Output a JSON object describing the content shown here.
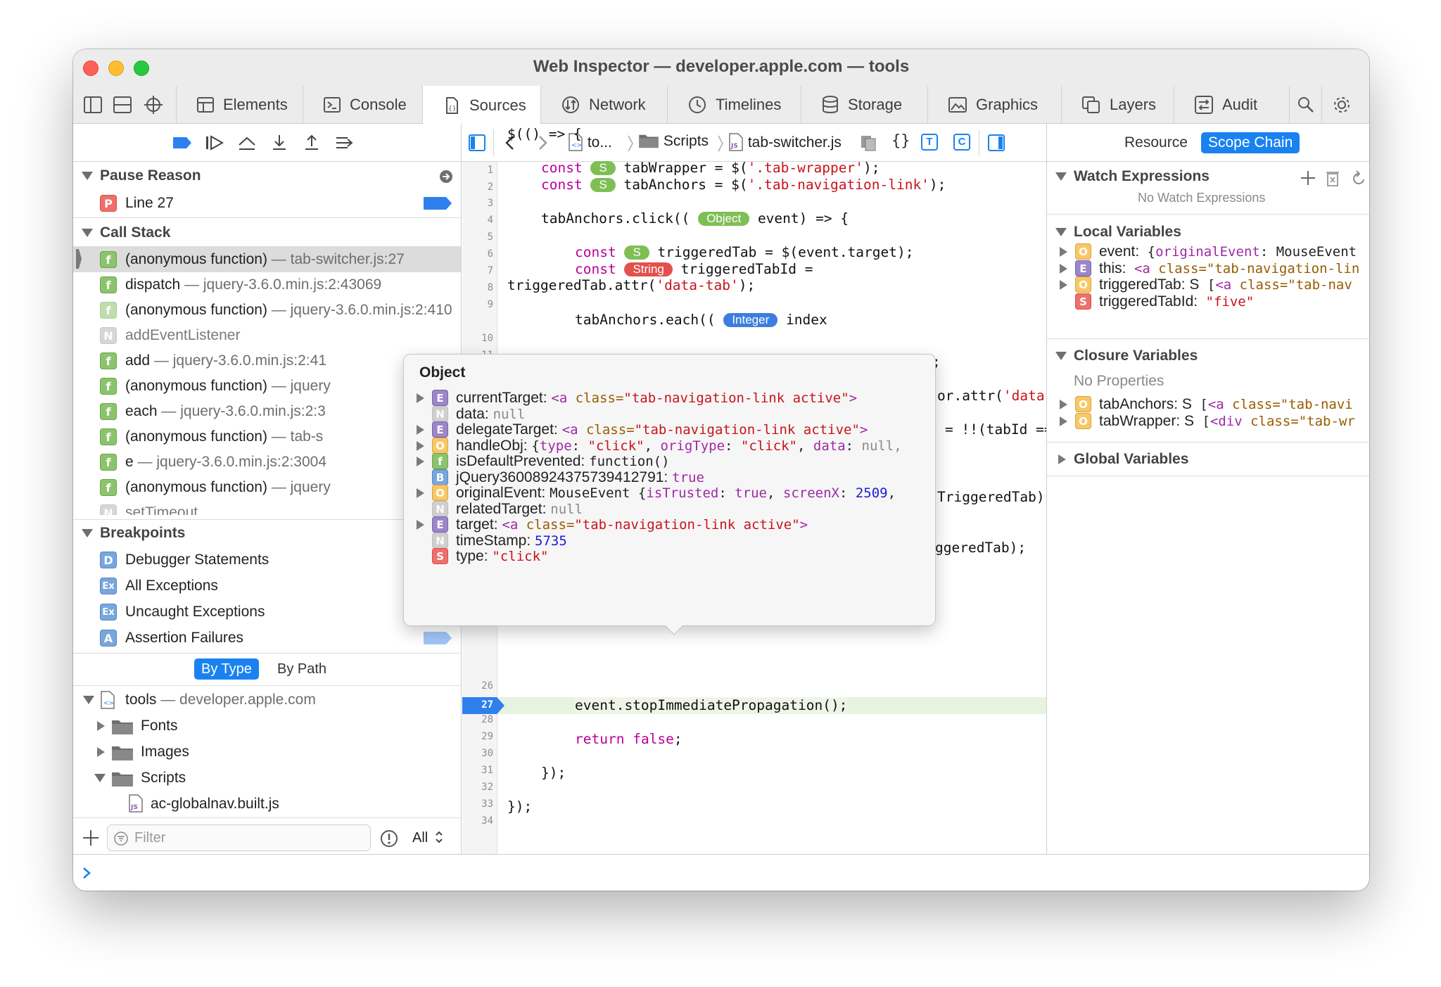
{
  "window": {
    "title": "Web Inspector — developer.apple.com — tools"
  },
  "tabs": [
    {
      "label": "Elements",
      "icon": "elements-icon"
    },
    {
      "label": "Console",
      "icon": "console-icon"
    },
    {
      "label": "Sources",
      "icon": "sources-icon",
      "active": true
    },
    {
      "label": "Network",
      "icon": "network-icon"
    },
    {
      "label": "Timelines",
      "icon": "timelines-icon"
    },
    {
      "label": "Storage",
      "icon": "storage-icon"
    },
    {
      "label": "Graphics",
      "icon": "graphics-icon"
    },
    {
      "label": "Layers",
      "icon": "layers-icon"
    },
    {
      "label": "Audit",
      "icon": "audit-icon"
    }
  ],
  "left": {
    "pause_reason_header": "Pause Reason",
    "pause_reason": {
      "badge": "P",
      "label": "Line 27"
    },
    "call_stack_header": "Call Stack",
    "call_stack": [
      {
        "badge": "f",
        "name": "(anonymous function)",
        "loc": "tab-switcher.js:27"
      },
      {
        "badge": "f",
        "name": "dispatch",
        "loc": "jquery-3.6.0.min.js:2:43069"
      },
      {
        "badge": "f",
        "name": "(anonymous function)",
        "loc": "jquery-3.6.0.min.js:2:410"
      },
      {
        "badge": "N",
        "name": "addEventListener",
        "loc": ""
      },
      {
        "badge": "f",
        "name": "add",
        "loc": "jquery-3.6.0.min.js:2:41"
      },
      {
        "badge": "f",
        "name": "(anonymous function)",
        "loc": "jquery"
      },
      {
        "badge": "f",
        "name": "each",
        "loc": "jquery-3.6.0.min.js:2:3"
      },
      {
        "badge": "f",
        "name": "(anonymous function)",
        "loc": "tab-s"
      },
      {
        "badge": "f",
        "name": "e",
        "loc": "jquery-3.6.0.min.js:2:3004"
      },
      {
        "badge": "f",
        "name": "(anonymous function)",
        "loc": "jquery"
      },
      {
        "badge": "N",
        "name": "setTimeout",
        "loc": ""
      }
    ],
    "breakpoints_header": "Breakpoints",
    "breakpoints": [
      {
        "badge": "D",
        "label": "Debugger Statements"
      },
      {
        "badge": "Ex",
        "label": "All Exceptions"
      },
      {
        "badge": "Ex",
        "label": "Uncaught Exceptions"
      },
      {
        "badge": "A",
        "label": "Assertion Failures"
      }
    ],
    "by_type": "By Type",
    "by_path": "By Path",
    "tree": {
      "root": "tools",
      "root_domain": "developer.apple.com",
      "folders": [
        "Fonts",
        "Images",
        "Scripts"
      ],
      "file": "ac-globalnav.built.js"
    },
    "filter_placeholder": "Filter",
    "filter_scope": "All"
  },
  "center": {
    "breadcrumb": [
      "to...",
      "Scripts",
      "tab-switcher.js"
    ],
    "toggle_t": "T",
    "toggle_c": "C",
    "line_numbers": [
      "1",
      "2",
      "3",
      "4",
      "5",
      "6",
      "7",
      "8",
      "9",
      "10",
      "11",
      "26",
      "27",
      "28",
      "29",
      "30",
      "31",
      "32",
      "33",
      "34"
    ],
    "current_line": "27",
    "code": {
      "l1": "$(() => {",
      "l3_kw": "const",
      "l3_type": "S",
      "l3_rest": " tabWrapper = $(",
      "l3_str": "'.tab-wrapper'",
      "l3_end": ");",
      "l4_kw": "const",
      "l4_type": "S",
      "l4_rest": " tabAnchors = $(",
      "l4_str": "'.tab-navigation-link'",
      "l4_end": ");",
      "l6_pre": "tabAnchors.click(( ",
      "l6_type": "Object",
      "l6_rest": " event) => {",
      "l8_kw": "const",
      "l8_type": "S",
      "l8_rest": " triggeredTab = $(event.target);",
      "l9_kw": "const",
      "l9_type": "String",
      "l9_rest": " triggeredTabId =",
      "l9b_pre": "triggeredTab.attr(",
      "l9b_str": "'data-tab'",
      "l9b_end": ");",
      "l11_pre": "tabAnchors.each(( ",
      "l11_type": "Integer",
      "l11_rest": " index",
      "f1": ";",
      "f2_pre": "or.attr(",
      "f2_str": "'data-tab'",
      "f2_end": ");",
      "f3": "= !!(tabId ===",
      "f4": "TriggeredTab);",
      "f5": "ggeredTab);",
      "l27": "event.stopImmediatePropagation();",
      "l29_kw": "return",
      "l29_kw2": "false",
      "l29_end": ";",
      "l31": "});",
      "l33": "});"
    }
  },
  "popover": {
    "title": "Object",
    "rows": [
      {
        "badge": "E",
        "key": "currentTarget:",
        "expandable": true,
        "kind": "element",
        "tag": "<a ",
        "attr": "class=",
        "val": "\"tab-navigation-link active\"",
        "close": ">"
      },
      {
        "badge": "N",
        "key": "data:",
        "expandable": false,
        "kind": "null",
        "text": "null"
      },
      {
        "badge": "E",
        "key": "delegateTarget:",
        "expandable": true,
        "kind": "element",
        "tag": "<a ",
        "attr": "class=",
        "val": "\"tab-navigation-link active\"",
        "close": ">"
      },
      {
        "badge": "O",
        "key": "handleObj:",
        "expandable": true,
        "kind": "handleobj"
      },
      {
        "badge": "f",
        "key": "isDefaultPrevented:",
        "expandable": true,
        "kind": "plain",
        "text": "function()"
      },
      {
        "badge": "B",
        "key": "jQuery36008924375739412791:",
        "expandable": false,
        "kind": "bool",
        "text": "true"
      },
      {
        "badge": "O",
        "key": "originalEvent:",
        "expandable": true,
        "kind": "origevent"
      },
      {
        "badge": "N",
        "key": "relatedTarget:",
        "expandable": false,
        "kind": "null",
        "text": "null"
      },
      {
        "badge": "E",
        "key": "target:",
        "expandable": true,
        "kind": "element",
        "tag": "<a ",
        "attr": "class=",
        "val": "\"tab-navigation-link active\"",
        "close": ">"
      },
      {
        "badge": "N",
        "key": "timeStamp:",
        "expandable": false,
        "kind": "number",
        "text": "5735"
      },
      {
        "badge": "S",
        "key": "type:",
        "expandable": false,
        "kind": "string",
        "text": "\"click\""
      }
    ],
    "handleobj": {
      "open": "{",
      "k1": "type",
      "v1": "\"click\"",
      "k2": "origType",
      "v2": "\"click\"",
      "k3": "data",
      "v3": "null,"
    },
    "origevent": {
      "cls": "MouseEvent",
      "open": " {",
      "k1": "isTrusted",
      "v1": "true",
      "k2": "screenX",
      "v2": "2509",
      "tail": ","
    }
  },
  "right": {
    "resource": "Resource",
    "scope_chain": "Scope Chain",
    "watch_header": "Watch Expressions",
    "no_watch": "No Watch Expressions",
    "local_header": "Local Variables",
    "locals": [
      {
        "badge": "O",
        "name": "event:",
        "a": " {",
        "b": "originalEvent",
        "c": ": MouseEvent"
      },
      {
        "badge": "E",
        "name": "this:",
        "a": " ",
        "b": "<a ",
        "c": "class=\"tab-navigation-lin"
      },
      {
        "badge": "O",
        "name": "triggeredTab: S",
        "a": " [",
        "b": "<a ",
        "c": "class=\"tab-nav"
      },
      {
        "badge": "S",
        "name": "triggeredTabId:",
        "a": " ",
        "b": "",
        "c": "\"five\""
      }
    ],
    "closure_header": "Closure Variables",
    "no_props": "No Properties",
    "closures": [
      {
        "badge": "O",
        "name": "tabAnchors: S",
        "a": " [",
        "b": "<a ",
        "c": "class=\"tab-navi"
      },
      {
        "badge": "O",
        "name": "tabWrapper: S",
        "a": " [",
        "b": "<div ",
        "c": "class=\"tab-wr"
      }
    ],
    "global_header": "Global Variables"
  },
  "colors": {
    "accent": "#1a82f0",
    "breakpoint": "#2f80ed",
    "string": "#c7141b",
    "keyword": "#b8019a"
  }
}
